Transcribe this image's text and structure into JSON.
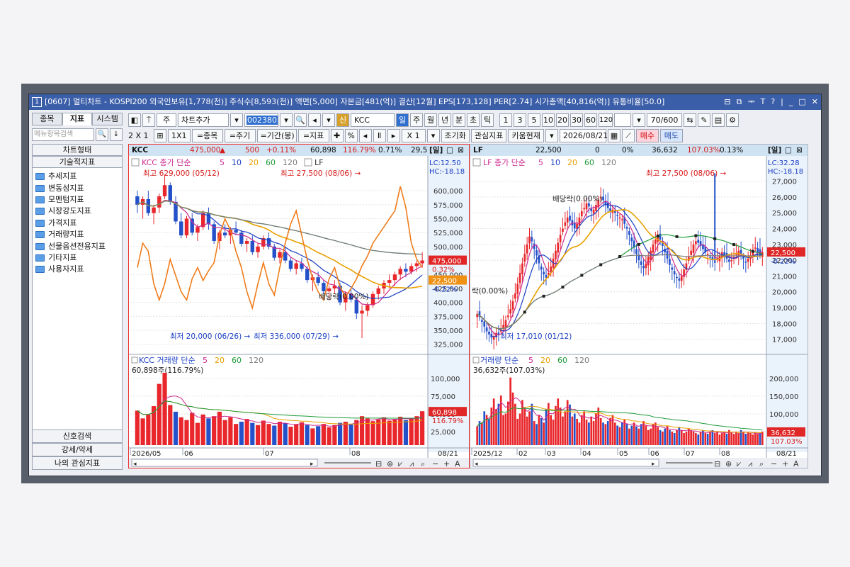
{
  "window": {
    "title": "[0607] 멀티차트 - KOSPI200 외국인보유[1,778(천)] 주식수[8,593(천)] 액면[5,000] 자본금[481(억)] 결산[12월] EPS[173,128] PER[2.74] 시가총액[40,816(억)] 유통비율[50.0]",
    "screen_no": "1",
    "controls": [
      "⊟",
      "⧉",
      "ᆍ",
      "T",
      "?",
      "|",
      "_",
      "□",
      "✕"
    ]
  },
  "left_panel": {
    "tabs": [
      "종목",
      "지표",
      "시스템"
    ],
    "active_tab": "지표",
    "search_placeholder": "메뉴항목검색",
    "sections": [
      "차트형태",
      "기술적지표"
    ],
    "tree": [
      "추세지표",
      "변동성지표",
      "모멘텀지표",
      "시장강도지표",
      "가격지표",
      "거래량지표",
      "선물옵션전용지표",
      "기타지표",
      "사용자지표"
    ],
    "bottom": [
      "신호검색",
      "강세/약세",
      "나의 관심지표"
    ]
  },
  "toolbar1": {
    "period_sel": "주",
    "add_chart": "차트추가",
    "code": "002380",
    "badge": "신",
    "name": "KCC",
    "periods": [
      "일",
      "주",
      "월",
      "년",
      "분",
      "초",
      "틱"
    ],
    "active_period": "일",
    "intervals": [
      "1",
      "3",
      "5",
      "10",
      "20",
      "30",
      "60",
      "120"
    ],
    "count": "70/600"
  },
  "toolbar2": {
    "layout": "2 X 1",
    "grid_btn": "1X1",
    "btn_stock": "=종목",
    "btn_cycle": "=주기",
    "btn_range": "=기간(봉)",
    "btn_indicator": "=지표",
    "mult": "X 1",
    "reset": "초기화",
    "interest": "관심지표",
    "kiwoom": "키움현재",
    "date": "2026/08/21",
    "buy": "매수",
    "sell": "매도"
  },
  "chart_data": [
    {
      "type": "candlestick",
      "info": {
        "name": "KCC",
        "price": "475,000",
        "arrow": "▲",
        "change": "500",
        "pct": "+0.11%",
        "volume": "60,898",
        "vol_ratio": "116.79%",
        "turnover": "0.71%",
        "trunc": "29,5",
        "period_tag": "[일]"
      },
      "legend": {
        "name": "KCC",
        "label": "종가 단순",
        "mas": [
          "5",
          "10",
          "20",
          "60",
          "120"
        ],
        "compare": "LF"
      },
      "lc": "LC:12.50",
      "hc": "HC:-18.18",
      "high_label": "최고 629,000 (05/12)",
      "high2_label": "최고 27,500 (08/06)",
      "low_label": "최저 20,000 (06/26)",
      "low2_label": "최저 336,000 (07/29)",
      "div_label": "배당락(0.00%)",
      "y_ticks": [
        "600,000",
        "575,000",
        "550,000",
        "525,000",
        "500,000",
        "475,000",
        "450,000",
        "425,000",
        "400,000",
        "375,000",
        "350,000",
        "325,000"
      ],
      "ylim": [
        317000,
        637000
      ],
      "last_price_tag": "475,000",
      "last_pct_tag": "0.32%",
      "cmp_price_tag": "22,500",
      "cmp_pct_tag": "-0.22%",
      "volume_legend": {
        "name": "KCC 거래량",
        "label": "단순",
        "mas": [
          "5",
          "20",
          "60",
          "120"
        ]
      },
      "volume_note": "60,898주(116.79%)",
      "volume_ticks": [
        "100,000",
        "75,000",
        "50,000",
        "25,000"
      ],
      "volume_tag": "60,898",
      "volume_pct_tag": "116.79%",
      "x_labels": [
        "2026/05",
        "06",
        "07",
        "08"
      ],
      "date_tag": "08/21",
      "candles": [
        [
          590000,
          600000,
          560000,
          575000
        ],
        [
          575000,
          590000,
          550000,
          585000
        ],
        [
          585000,
          600000,
          555000,
          560000
        ],
        [
          560000,
          575000,
          540000,
          570000
        ],
        [
          570000,
          595000,
          560000,
          590000
        ],
        [
          590000,
          629000,
          585000,
          610000
        ],
        [
          610000,
          615000,
          575000,
          580000
        ],
        [
          580000,
          590000,
          540000,
          545000
        ],
        [
          545000,
          560000,
          515000,
          520000
        ],
        [
          520000,
          555000,
          515000,
          550000
        ],
        [
          550000,
          560000,
          520000,
          525000
        ],
        [
          525000,
          540000,
          510000,
          535000
        ],
        [
          535000,
          565000,
          530000,
          560000
        ],
        [
          560000,
          570000,
          530000,
          540000
        ],
        [
          540000,
          545000,
          505000,
          510000
        ],
        [
          510000,
          530000,
          495000,
          525000
        ],
        [
          525000,
          540000,
          515000,
          520000
        ],
        [
          520000,
          535000,
          505000,
          530000
        ],
        [
          530000,
          545000,
          520000,
          525000
        ],
        [
          525000,
          530000,
          500000,
          505000
        ],
        [
          505000,
          515000,
          490000,
          510000
        ],
        [
          510000,
          520000,
          485000,
          490000
        ],
        [
          490000,
          505000,
          480000,
          500000
        ],
        [
          500000,
          520000,
          495000,
          515000
        ],
        [
          515000,
          525000,
          495000,
          500000
        ],
        [
          500000,
          505000,
          475000,
          480000
        ],
        [
          480000,
          495000,
          470000,
          490000
        ],
        [
          490000,
          500000,
          470000,
          475000
        ],
        [
          475000,
          480000,
          455000,
          460000
        ],
        [
          460000,
          475000,
          450000,
          470000
        ],
        [
          470000,
          480000,
          455000,
          460000
        ],
        [
          460000,
          465000,
          435000,
          440000
        ],
        [
          440000,
          450000,
          420000,
          445000
        ],
        [
          445000,
          455000,
          430000,
          435000
        ],
        [
          435000,
          440000,
          415000,
          420000
        ],
        [
          420000,
          430000,
          405000,
          425000
        ],
        [
          425000,
          440000,
          415000,
          430000
        ],
        [
          430000,
          435000,
          395000,
          400000
        ],
        [
          400000,
          420000,
          385000,
          415000
        ],
        [
          415000,
          425000,
          400000,
          405000
        ],
        [
          405000,
          410000,
          370000,
          380000
        ],
        [
          380000,
          395000,
          336000,
          385000
        ],
        [
          385000,
          400000,
          375000,
          395000
        ],
        [
          395000,
          420000,
          390000,
          415000
        ],
        [
          415000,
          430000,
          405000,
          425000
        ],
        [
          425000,
          440000,
          415000,
          435000
        ],
        [
          435000,
          450000,
          425000,
          440000
        ],
        [
          440000,
          455000,
          430000,
          450000
        ],
        [
          450000,
          465000,
          440000,
          460000
        ],
        [
          460000,
          470000,
          445000,
          455000
        ],
        [
          455000,
          470000,
          450000,
          465000
        ],
        [
          465000,
          475000,
          455000,
          470000
        ],
        [
          470000,
          490000,
          462000,
          475000
        ]
      ],
      "lf_series": [
        22500,
        24000,
        23500,
        21500,
        20500,
        21500,
        23000,
        22000,
        21000,
        20500,
        21800,
        22500,
        21700,
        22300,
        22800,
        24500,
        25500,
        24800,
        23500,
        22500,
        21000,
        20000,
        21500,
        22800,
        21500,
        20800,
        22500,
        24000,
        25200,
        26000,
        24500,
        23000,
        21800,
        21000,
        20500,
        21800,
        22500,
        21300,
        20700,
        21200,
        21800,
        22600,
        23200,
        24000,
        24500,
        25000,
        25500,
        26000,
        27500,
        26200,
        24000,
        23000,
        22500
      ],
      "volumes": [
        62000,
        48000,
        55000,
        70000,
        110000,
        130000,
        72000,
        60000,
        50000,
        45000,
        58000,
        40000,
        55000,
        48000,
        52000,
        60000,
        45000,
        50000,
        38000,
        42000,
        47000,
        40000,
        36000,
        44000,
        38000,
        35000,
        42000,
        39000,
        33000,
        37000,
        41000,
        36000,
        30000,
        34000,
        38000,
        32000,
        36000,
        40000,
        42000,
        37000,
        45000,
        52000,
        48000,
        43000,
        46000,
        50000,
        44000,
        47000,
        51000,
        45000,
        48000,
        52000,
        60898
      ]
    },
    {
      "type": "candlestick",
      "info": {
        "name": "LF",
        "price": "22,500",
        "change": "0",
        "pct": "0%",
        "volume": "36,632",
        "vol_ratio": "107.03%",
        "turnover": "0.13%",
        "period_tag": "[일]"
      },
      "legend": {
        "name": "LF",
        "label": "종가 단순",
        "mas": [
          "5",
          "10",
          "20",
          "60",
          "120"
        ]
      },
      "lc": "LC:32.28",
      "hc": "HC:-18.18",
      "high_label": "최고 27,500 (08/06)",
      "low_label": "최저 17,010 (01/12)",
      "div_label": "배당락(0.00%)",
      "div_label2": "락(0.00%)",
      "y_ticks": [
        "27,000",
        "26,000",
        "25,000",
        "24,000",
        "23,000",
        "22,000",
        "21,000",
        "20,000",
        "19,000",
        "18,000",
        "17,000"
      ],
      "ylim": [
        16400,
        27700
      ],
      "last_price_tag": "22,500",
      "last_pct_tag": "-0.22%",
      "volume_legend": {
        "name": "거래량",
        "label": "단순",
        "mas": [
          "5",
          "20",
          "60",
          "120"
        ]
      },
      "volume_note": "36,632주(107.03%)",
      "volume_ticks": [
        "200,000",
        "150,000",
        "100,000",
        "50,000"
      ],
      "volume_tag": "36,632",
      "volume_pct_tag": "107.03%",
      "x_labels": [
        "2025/12",
        "02",
        "03",
        "04",
        "05",
        "06",
        "07",
        "08"
      ],
      "date_tag": "08/21",
      "closes": [
        18600,
        18400,
        18100,
        17800,
        17500,
        17300,
        17100,
        17200,
        17400,
        17300,
        17600,
        17900,
        18200,
        18500,
        18900,
        19400,
        19900,
        20500,
        21200,
        21800,
        22400,
        23000,
        23500,
        23200,
        22700,
        22300,
        21800,
        21400,
        21100,
        20900,
        21200,
        21600,
        22100,
        22600,
        23100,
        23600,
        24000,
        24400,
        24700,
        24500,
        24200,
        24000,
        24300,
        24700,
        25100,
        25300,
        25600,
        25400,
        25100,
        25200,
        25500,
        25800,
        26000,
        25800,
        25500,
        25300,
        25100,
        25200,
        25000,
        24800,
        24700,
        24600,
        24300,
        24000,
        23600,
        23200,
        22800,
        22400,
        22000,
        21700,
        21500,
        21800,
        22200,
        22600,
        23000,
        23300,
        23600,
        23300,
        22900,
        22500,
        22100,
        21700,
        21400,
        21100,
        20900,
        20700,
        21000,
        21400,
        21800,
        22200,
        22600,
        23000,
        23200,
        23100,
        22900,
        22700,
        22500,
        22400,
        22200,
        22000,
        21900,
        22100,
        22300,
        22500,
        22300,
        22100,
        21900,
        22000,
        22200,
        22400,
        22600,
        22400,
        22100,
        21900,
        22100,
        22300,
        22600,
        22800,
        22500,
        22300,
        22500
      ],
      "spikes": [
        [
          100,
          27500
        ]
      ],
      "volume_heights": [
        0.25,
        0.32,
        0.3,
        0.45,
        0.4,
        0.35,
        0.5,
        0.62,
        0.48,
        0.55,
        0.66,
        0.4,
        0.42,
        0.58,
        0.9,
        0.7,
        0.55,
        0.35,
        0.42,
        0.6,
        0.5,
        0.38,
        0.45,
        0.55,
        0.32,
        0.28,
        0.4,
        0.36,
        0.3,
        0.48,
        0.56,
        0.4,
        0.34,
        0.52,
        0.62,
        0.5,
        0.38,
        0.45,
        0.6,
        0.54,
        0.38,
        0.42,
        0.35,
        0.3,
        0.4,
        0.45,
        0.34,
        0.3,
        0.38,
        0.32,
        0.42,
        0.5,
        0.36,
        0.3,
        0.28,
        0.32,
        0.36,
        0.4,
        0.3,
        0.26,
        0.24,
        0.3,
        0.34,
        0.28,
        0.22,
        0.26,
        0.3,
        0.25,
        0.22,
        0.28,
        0.32,
        0.26,
        0.2,
        0.22,
        0.28,
        0.3,
        0.24,
        0.2,
        0.18,
        0.22,
        0.26,
        0.2,
        0.18,
        0.16,
        0.2,
        0.24,
        0.2,
        0.16,
        0.18,
        0.22,
        0.2,
        0.18,
        0.16,
        0.14,
        0.18,
        0.2,
        0.16,
        0.15,
        0.18,
        0.2,
        0.16,
        0.18,
        0.14,
        0.16,
        0.18,
        0.15,
        0.2,
        0.17,
        0.15,
        0.18,
        0.16,
        0.2,
        0.18,
        0.15,
        0.17,
        0.16,
        0.14,
        0.17,
        0.15,
        0.16,
        0.18
      ]
    }
  ],
  "colors": {
    "up": "#e8262b",
    "down": "#2451c9",
    "ma5": "#cc2a8f",
    "ma10": "#1a3fc4",
    "ma20": "#e8a000",
    "ma60": "#1f9b3a",
    "ma120": "#7b7b7b",
    "lf": "#ef7c1a",
    "accent": "#3b5ea8"
  }
}
